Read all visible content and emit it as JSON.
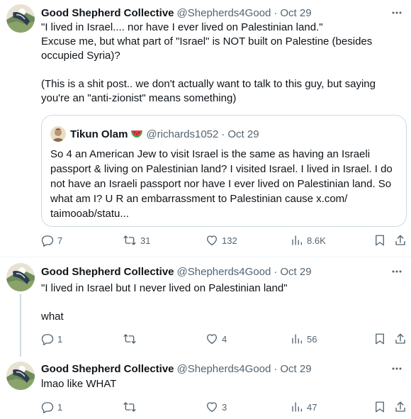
{
  "colors": {
    "text": "#0f1419",
    "secondary": "#536471",
    "border": "#cfd9de"
  },
  "tweets": [
    {
      "name": "Good Shepherd Collective",
      "handle": "@Shepherds4Good",
      "dot": "·",
      "time": "Oct 29",
      "text": "\"I lived in Israel.... nor have I ever lived on Palestinian land.\"\nExcuse me, but what part of \"Israel\" is NOT built on Palestine (besides occupied Syria)?\n\n(This is a shit post.. we don't actually want to talk to this guy, but saying you're an \"anti-zionist\" means something)",
      "quote": {
        "name": "Tikun Olam",
        "emoji": "watermelon",
        "handle": "@richards1052",
        "dot": "·",
        "time": "Oct 29",
        "text": "So 4 an American Jew to visit Israel is the same as having an Israeli passport & living on Palestinian land? I visited Israel. I lived in Israel. I do not have an Israeli passport nor have I ever lived on Palestinian land. So what am I? U R an embarrassment to Palestinian cause x.com/ taimooab/statu..."
      },
      "replies": "7",
      "reposts": "31",
      "likes": "132",
      "views": "8.6K"
    },
    {
      "name": "Good Shepherd Collective",
      "handle": "@Shepherds4Good",
      "dot": "·",
      "time": "Oct 29",
      "text": "\"I lived in Israel but I never lived on Palestinian land\"\n\nwhat",
      "replies": "1",
      "reposts": "",
      "likes": "4",
      "views": "56"
    },
    {
      "name": "Good Shepherd Collective",
      "handle": "@Shepherds4Good",
      "dot": "·",
      "time": "Oct 29",
      "text": "lmao like WHAT",
      "replies": "1",
      "reposts": "",
      "likes": "3",
      "views": "47"
    }
  ]
}
